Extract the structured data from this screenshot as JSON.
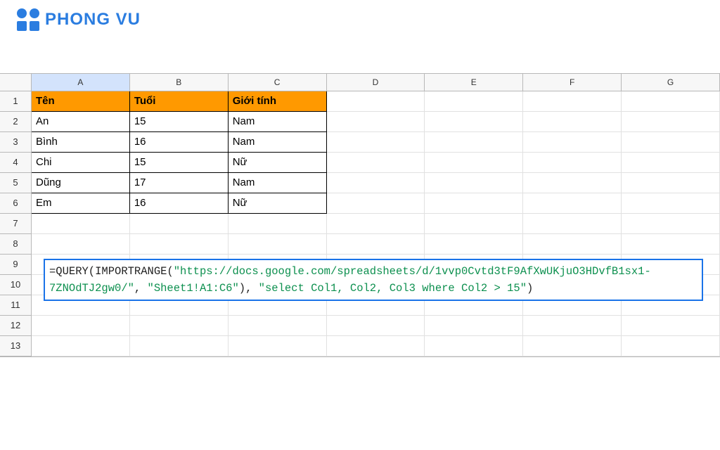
{
  "brand": "PHONG VU",
  "columns": [
    "A",
    "B",
    "C",
    "D",
    "E",
    "F",
    "G"
  ],
  "rows": [
    "1",
    "2",
    "3",
    "4",
    "5",
    "6",
    "7",
    "8",
    "9",
    "10",
    "11",
    "12",
    "13"
  ],
  "table": {
    "headers": [
      "Tên",
      "Tuổi",
      "Giới tính"
    ],
    "data": [
      [
        "An",
        "15",
        "Nam"
      ],
      [
        "Bình",
        "16",
        "Nam"
      ],
      [
        "Chi",
        "15",
        "Nữ"
      ],
      [
        "Dũng",
        "17",
        "Nam"
      ],
      [
        "Em",
        "16",
        "Nữ"
      ]
    ]
  },
  "formula": {
    "p1": "=QUERY(IMPORTRANGE(",
    "p2": "\"https://docs.google.com/spreadsheets/d/1vvp0Cvtd3tF9AfXwUKjuO3HDvfB1sx1-7ZNOdTJ2gw0/\"",
    "p3": ", ",
    "p4": "\"Sheet1!A1:C6\"",
    "p5": "), ",
    "p6": "\"select Col1, Col2, Col3 where Col2 > 15\"",
    "p7": ")"
  }
}
